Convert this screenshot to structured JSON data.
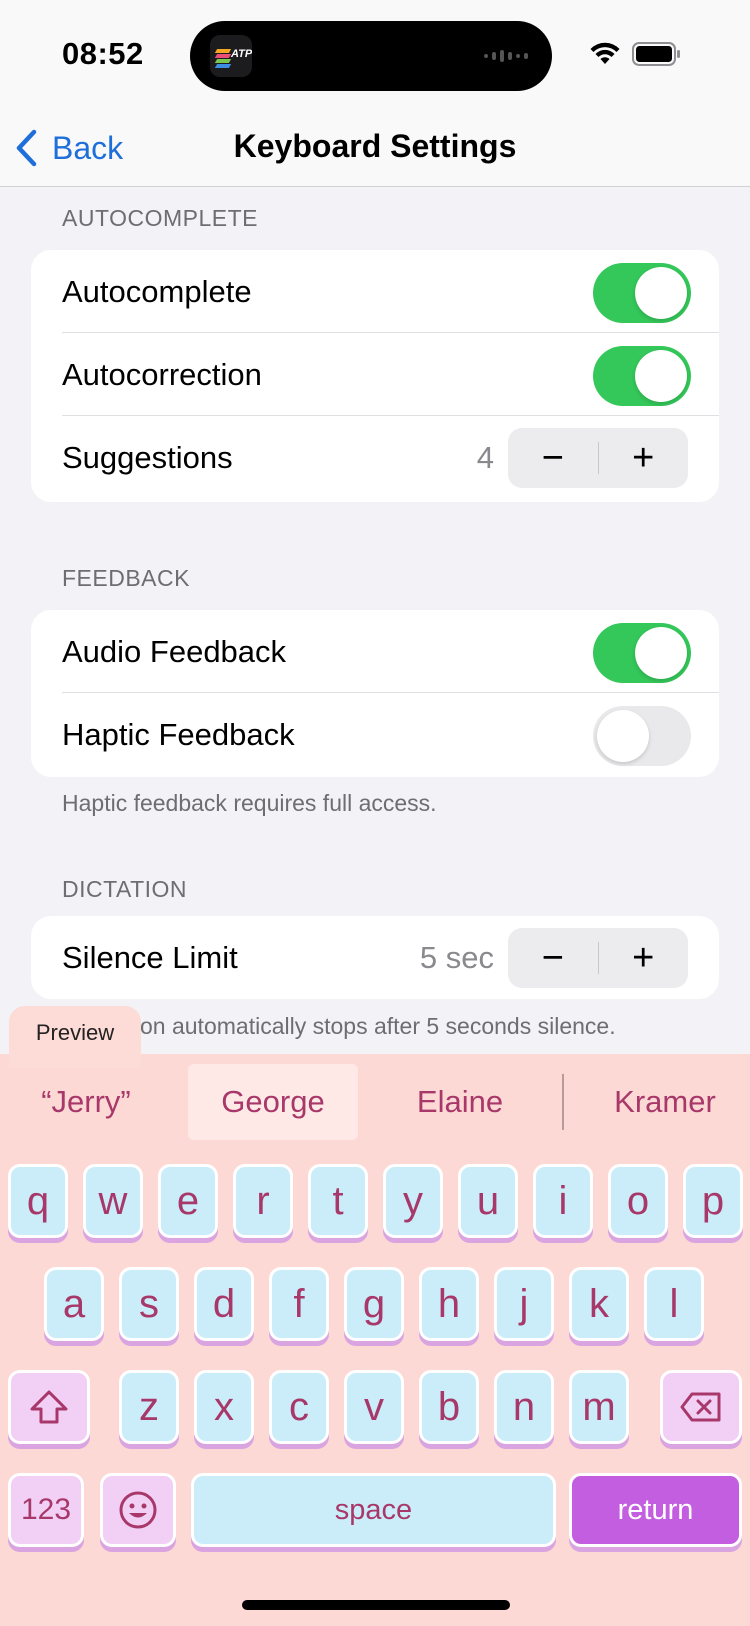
{
  "status": {
    "time": "08:52",
    "island_app_label": "ATP"
  },
  "nav": {
    "back_label": "Back",
    "title": "Keyboard Settings"
  },
  "sections": {
    "autocomplete": {
      "header": "AUTOCOMPLETE",
      "autocomplete_label": "Autocomplete",
      "autocomplete_on": true,
      "autocorrection_label": "Autocorrection",
      "autocorrection_on": true,
      "suggestions_label": "Suggestions",
      "suggestions_value": "4"
    },
    "feedback": {
      "header": "FEEDBACK",
      "audio_label": "Audio Feedback",
      "audio_on": true,
      "haptic_label": "Haptic Feedback",
      "haptic_on": false,
      "footer": "Haptic feedback requires full access."
    },
    "dictation": {
      "header": "DICTATION",
      "silence_label": "Silence Limit",
      "silence_value": "5 sec",
      "footer_partial": "on automatically stops after 5 seconds silence."
    }
  },
  "stepper": {
    "minus": "−",
    "plus": "+"
  },
  "keyboard": {
    "preview_tab": "Preview",
    "suggestions": [
      "“Jerry”",
      "George",
      "Elaine",
      "Kramer"
    ],
    "active_suggestion": "George",
    "row1": [
      "q",
      "w",
      "e",
      "r",
      "t",
      "y",
      "u",
      "i",
      "o",
      "p"
    ],
    "row2": [
      "a",
      "s",
      "d",
      "f",
      "g",
      "h",
      "j",
      "k",
      "l"
    ],
    "row3": [
      "z",
      "x",
      "c",
      "v",
      "b",
      "n",
      "m"
    ],
    "numbers_label": "123",
    "space_label": "space",
    "return_label": "return"
  },
  "colors": {
    "toggle_on": "#34c759",
    "link_blue": "#1e6fd9",
    "keyboard_bg": "#fdd9d6",
    "key_bg": "#cbedf9",
    "key_text": "#a8386a",
    "return_bg": "#c35ee0"
  },
  "icons": {
    "back": "chevron-left-icon",
    "wifi": "wifi-icon",
    "battery": "battery-icon",
    "shift": "shift-arrow-icon",
    "delete": "delete-backspace-icon",
    "emoji": "emoji-smile-icon"
  }
}
